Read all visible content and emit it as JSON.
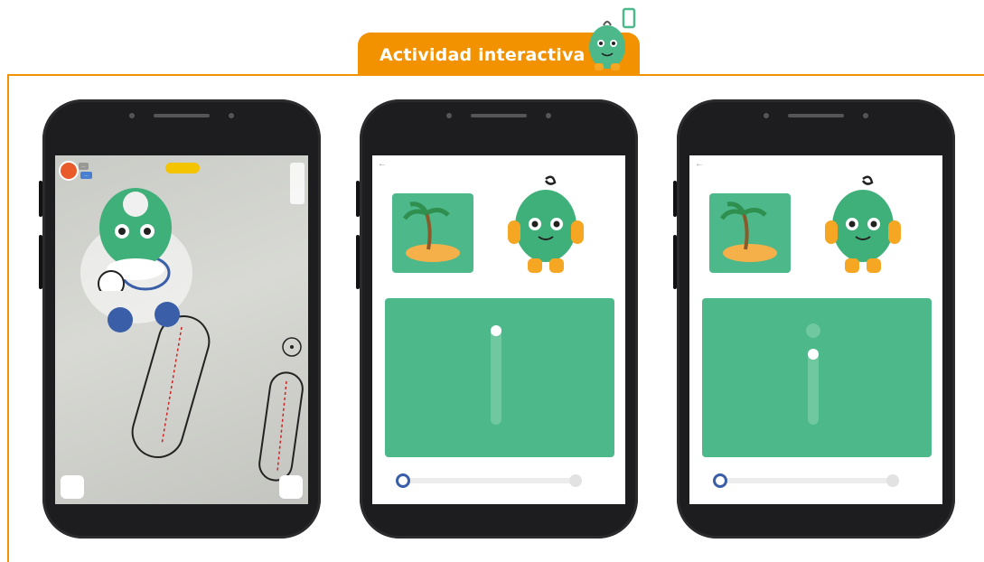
{
  "header": {
    "tab_label": "Actividad interactiva",
    "accent_color": "#f39200"
  },
  "phones": [
    {
      "screen": "ar-game",
      "hud": {
        "player_name": "…",
        "level_badge": "…"
      }
    },
    {
      "screen": "trace-letter",
      "letter_trace_progress": 0.0,
      "slider_value": 0.0
    },
    {
      "screen": "trace-letter",
      "letter_trace_progress": 0.25,
      "slider_value": 0.0
    }
  ],
  "colors": {
    "panel_green": "#4db88a",
    "slider_knob": "#3a5fa8",
    "phone_body": "#1d1d1f"
  }
}
